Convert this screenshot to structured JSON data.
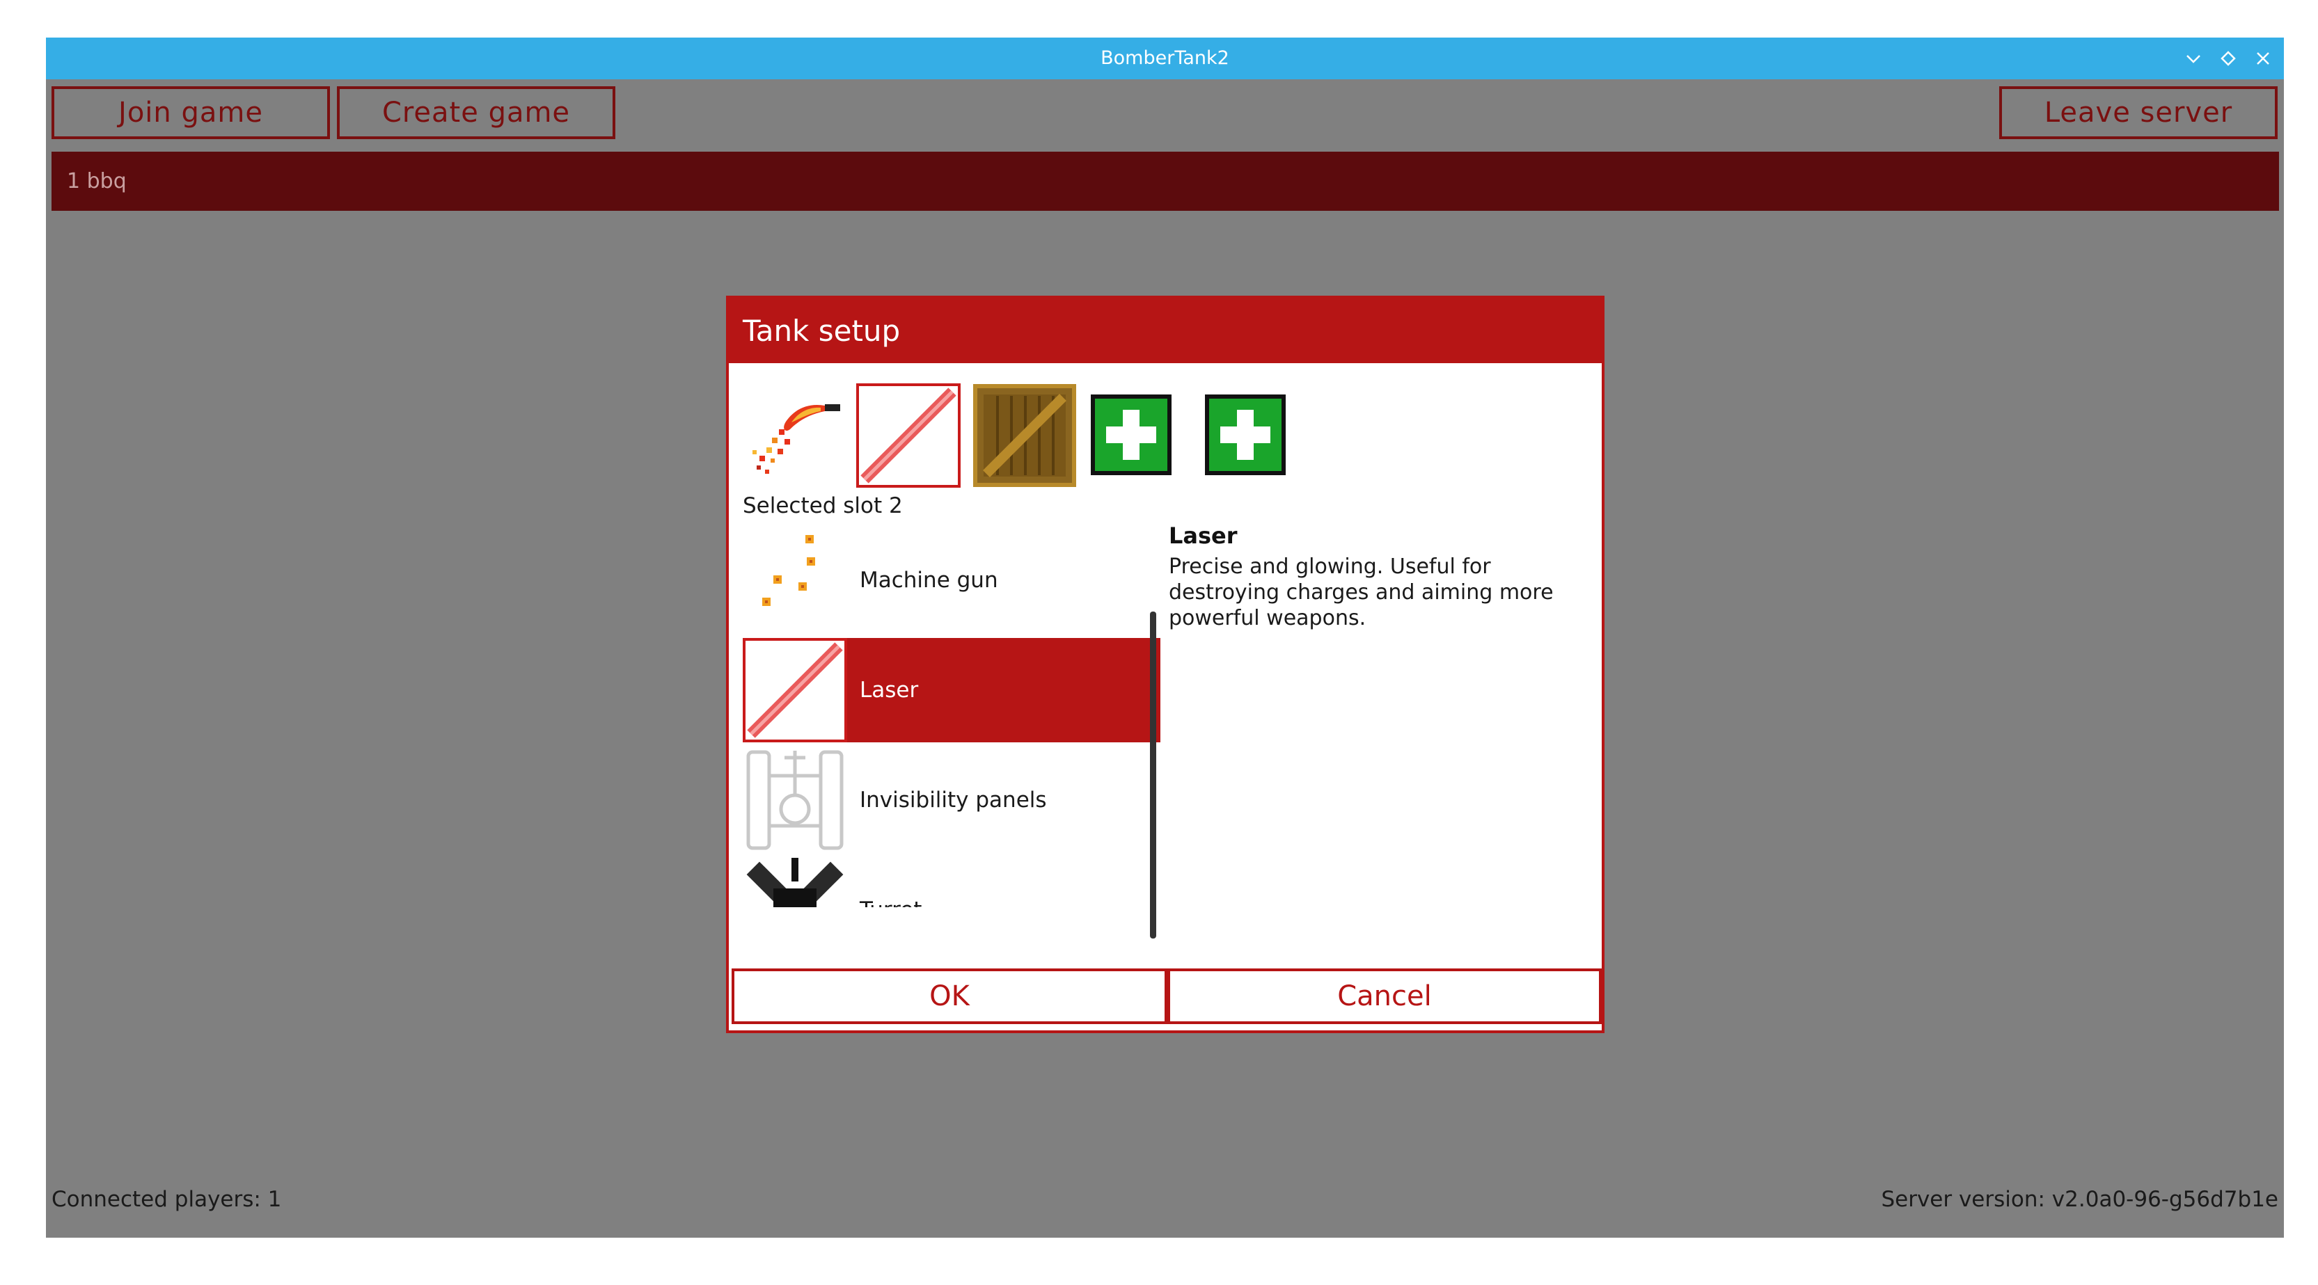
{
  "window": {
    "title": "BomberTank2",
    "titlebar_color": "#35aee6",
    "controls": [
      "minimize-icon",
      "maximize-icon",
      "close-icon"
    ]
  },
  "toolbar": {
    "join_label": "Join game",
    "create_label": "Create game",
    "leave_label": "Leave server"
  },
  "games": [
    {
      "label": "1 bbq"
    }
  ],
  "footer": {
    "players": "Connected players: 1",
    "version": "Server version: v2.0a0-96-g56d7b1e"
  },
  "dialog": {
    "title": "Tank setup",
    "slots": [
      {
        "icon": "flame-icon"
      },
      {
        "icon": "laser-icon",
        "selected": true
      },
      {
        "icon": "crate-icon"
      },
      {
        "icon": "health-plus-icon"
      },
      {
        "icon": "health-plus-icon"
      }
    ],
    "selected_slot_label": "Selected slot 2",
    "items": [
      {
        "label": "Machine gun",
        "icon": "machine-gun-icon"
      },
      {
        "label": "Laser",
        "icon": "laser-icon",
        "active": true
      },
      {
        "label": "Invisibility panels",
        "icon": "invisibility-panels-icon"
      },
      {
        "label": "Turret",
        "icon": "turret-icon"
      }
    ],
    "description": {
      "title": "Laser",
      "text": "Precise and glowing. Useful for destroying charges and aiming more powerful weapons."
    },
    "ok_label": "OK",
    "cancel_label": "Cancel",
    "accent_color": "#b61515"
  }
}
